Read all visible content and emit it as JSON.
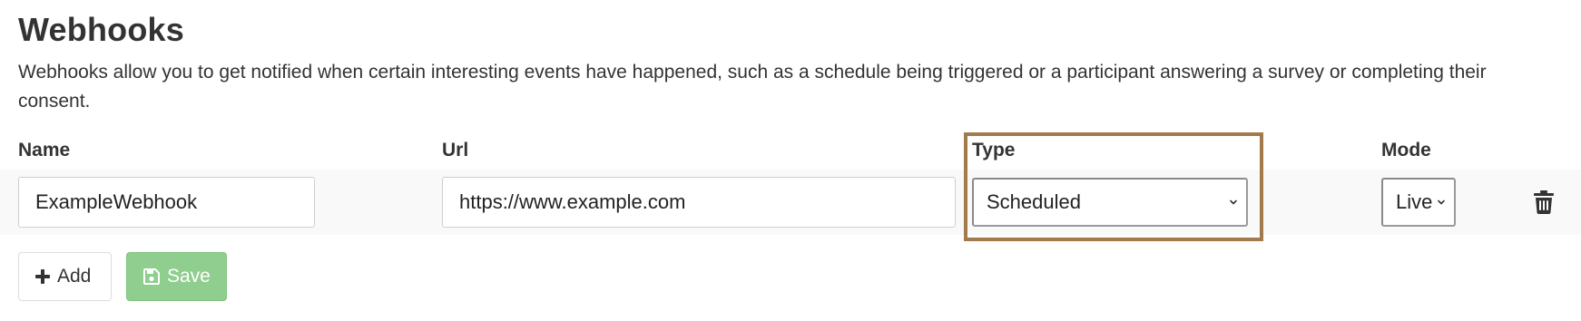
{
  "page": {
    "title": "Webhooks",
    "description": "Webhooks allow you to get notified when certain interesting events have happened, such as a schedule being triggered or a participant answering a survey or completing their consent."
  },
  "table": {
    "headers": {
      "name": "Name",
      "url": "Url",
      "type": "Type",
      "mode": "Mode"
    },
    "rows": [
      {
        "name": "ExampleWebhook",
        "url": "https://www.example.com",
        "type": "Scheduled",
        "mode": "Live",
        "delete_icon": "trash-icon"
      }
    ]
  },
  "actions": {
    "add_label": "Add",
    "add_icon": "plus-icon",
    "save_label": "Save",
    "save_icon": "floppy-disk-icon"
  },
  "colors": {
    "highlight": "#a27b4d",
    "save_button": "#8fce8f",
    "row_background": "#f9f9f9"
  }
}
